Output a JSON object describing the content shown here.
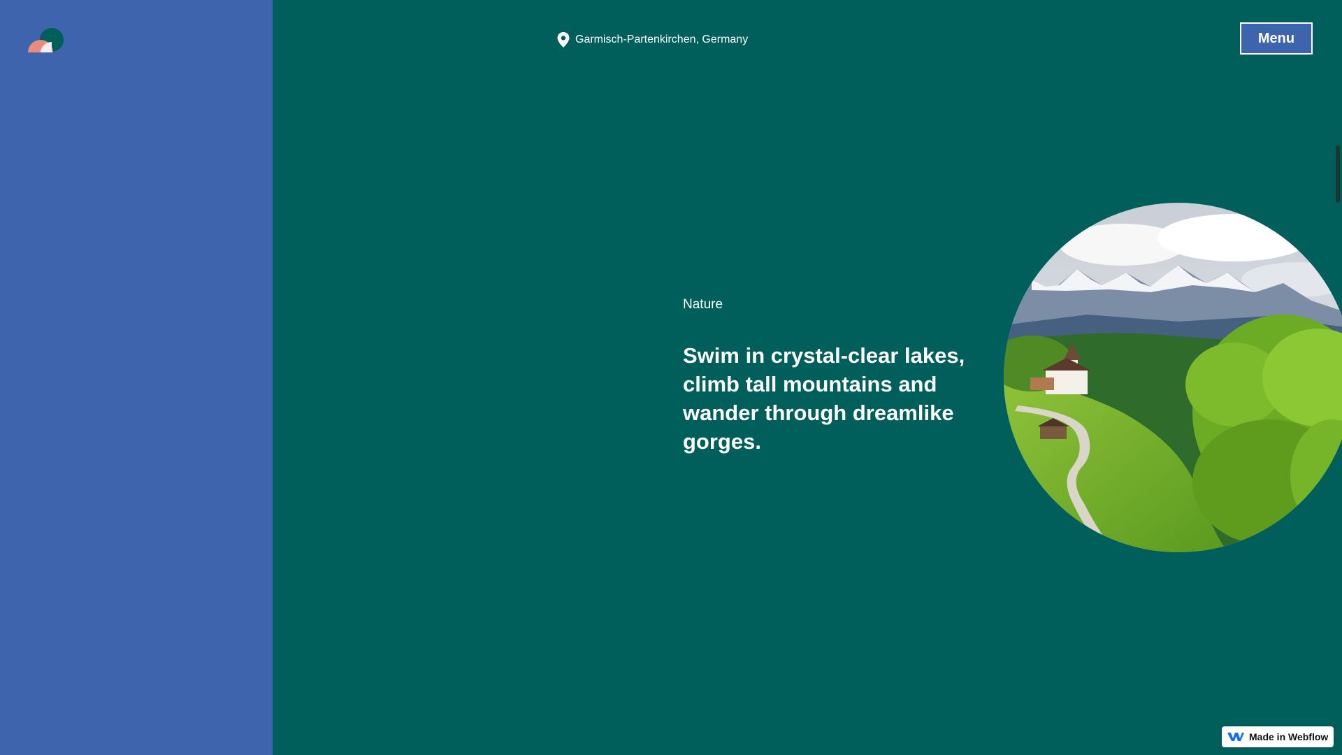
{
  "header": {
    "location": "Garmisch-Partenkirchen, Germany",
    "menu_label": "Menu"
  },
  "main": {
    "category": "Nature",
    "headline": "Swim in crystal-clear lakes, climb tall mountains and wander through dreamlike gorges."
  },
  "badge": {
    "label": "Made in Webflow"
  },
  "icons": {
    "logo": "site-logo",
    "location": "map-pin-icon",
    "webflow": "webflow-logo-icon"
  },
  "colors": {
    "background": "#005e5b",
    "left_panel": "#3e64ad",
    "menu_button": "#3e64ad",
    "text": "#ffffff"
  }
}
